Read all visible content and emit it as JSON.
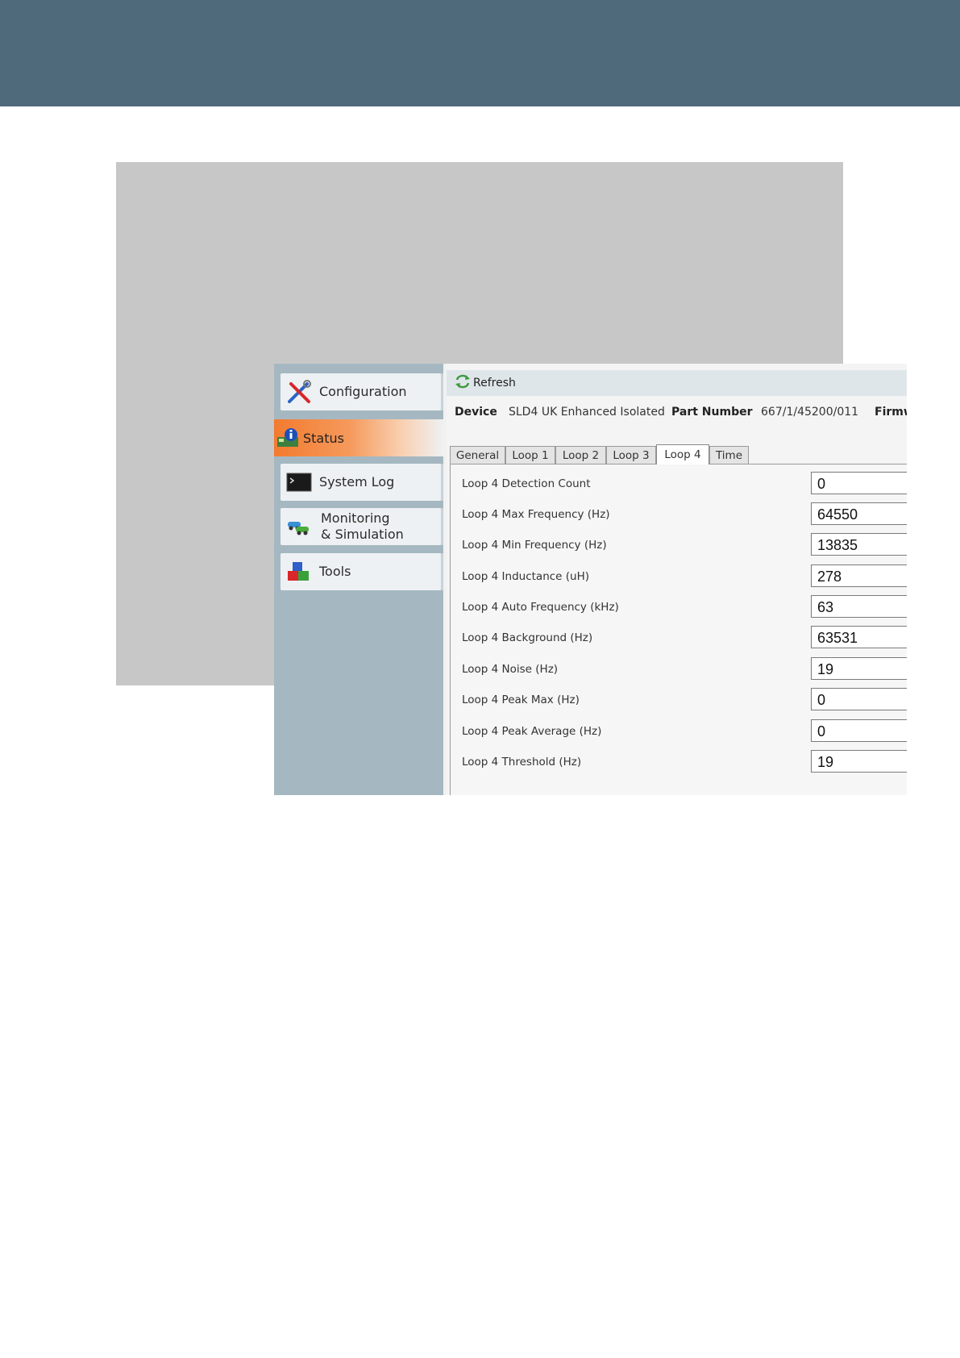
{
  "sidebar": {
    "items": [
      {
        "label": "Configuration",
        "icon": "tools-cross-icon"
      },
      {
        "label": "Status",
        "icon": "status-info-icon",
        "active": true
      },
      {
        "label": "System Log",
        "icon": "terminal-icon"
      },
      {
        "label": "Monitoring\n& Simulation",
        "line1": "Monitoring",
        "line2": "& Simulation",
        "icon": "cars-icon"
      },
      {
        "label": "Tools",
        "icon": "blocks-icon"
      }
    ]
  },
  "toolbar": {
    "refresh_label": "Refresh"
  },
  "device_info": {
    "device_label": "Device",
    "device_value": "SLD4 UK Enhanced Isolated",
    "part_label": "Part Number",
    "part_value": "667/1/45200/011",
    "firmware_label": "Firmw"
  },
  "tabs": [
    "General",
    "Loop 1",
    "Loop 2",
    "Loop 3",
    "Loop 4",
    "Time"
  ],
  "active_tab": "Loop 4",
  "fields": [
    {
      "label": "Loop 4 Detection Count",
      "value": "0"
    },
    {
      "label": "Loop 4 Max Frequency (Hz)",
      "value": "64550"
    },
    {
      "label": "Loop 4 Min Frequency (Hz)",
      "value": "13835"
    },
    {
      "label": "Loop 4 Inductance (uH)",
      "value": "278"
    },
    {
      "label": "Loop 4 Auto Frequency (kHz)",
      "value": "63"
    },
    {
      "label": "Loop 4 Background (Hz)",
      "value": "63531"
    },
    {
      "label": "Loop 4 Noise (Hz)",
      "value": "19"
    },
    {
      "label": "Loop 4 Peak Max (Hz)",
      "value": "0"
    },
    {
      "label": "Loop 4 Peak Average (Hz)",
      "value": "0"
    },
    {
      "label": "Loop 4 Threshold (Hz)",
      "value": "19"
    }
  ],
  "colors": {
    "banner": "#4e6a7b",
    "sidebar": "#a5b8c2",
    "active_accent": "#f37b2f"
  }
}
